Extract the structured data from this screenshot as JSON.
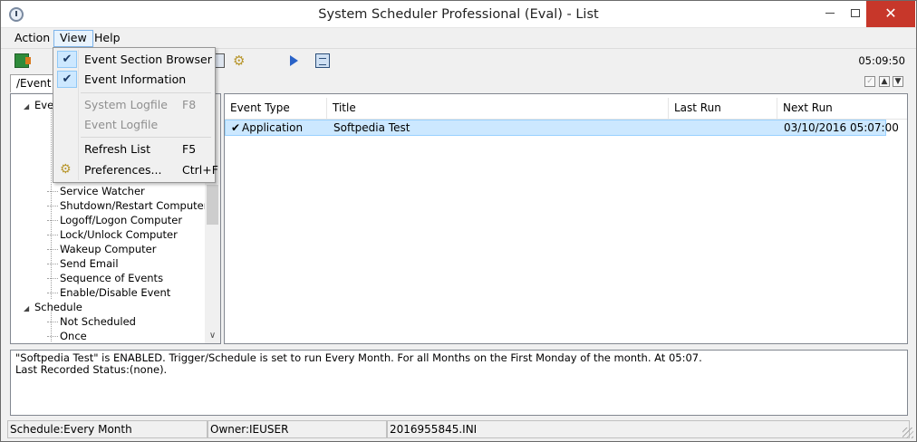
{
  "window": {
    "title": "System Scheduler Professional (Eval) - List",
    "minimize_icon": "minimize-icon",
    "maximize_icon": "maximize-icon",
    "close_glyph": "✕"
  },
  "menubar": {
    "action": "Action",
    "view": "View",
    "help": "Help"
  },
  "view_menu": {
    "items": [
      {
        "label": "Event Section Browser",
        "checked": true,
        "shortcut": ""
      },
      {
        "label": "Event Information",
        "checked": true,
        "shortcut": ""
      },
      {
        "label": "System Logfile",
        "shortcut": "F8",
        "disabled": true
      },
      {
        "label": "Event Logfile",
        "shortcut": "",
        "disabled": true
      },
      {
        "label": "Refresh List",
        "shortcut": "F5"
      },
      {
        "label": "Preferences...",
        "shortcut": "Ctrl+F",
        "icon": "gear-icon"
      }
    ]
  },
  "toolbar": {
    "time": "05:09:50"
  },
  "tab": {
    "label": "/Event Types"
  },
  "tree": {
    "top_group": "Event Types",
    "items": [
      "Service Watcher",
      "Shutdown/Restart Computer",
      "Logoff/Logon Computer",
      "Lock/Unlock Computer",
      "Wakeup Computer",
      "Send Email",
      "Sequence of Events",
      "Enable/Disable Event"
    ],
    "schedule_group": "Schedule",
    "schedule_items": [
      "Not Scheduled",
      "Once"
    ]
  },
  "list": {
    "columns": [
      "Event Type",
      "Title",
      "Last Run",
      "Next Run"
    ],
    "rows": [
      {
        "event_type": "Application",
        "title": "Softpedia Test",
        "last_run": "",
        "next_run": "03/10/2016 05:07:00",
        "check": "✔"
      }
    ]
  },
  "info": {
    "line1": "\"Softpedia Test\" is ENABLED. Trigger/Schedule is set to run Every Month. For all Months on the First Monday of the month. At 05:07.",
    "line2": "Last Recorded Status:(none)."
  },
  "status": {
    "schedule": "Schedule:Every Month",
    "owner": "Owner:IEUSER",
    "file": "2016955845.INI"
  },
  "colors": {
    "selection": "#cce8ff",
    "close_button": "#c7372a",
    "menu_highlight": "#e8f3fd"
  }
}
